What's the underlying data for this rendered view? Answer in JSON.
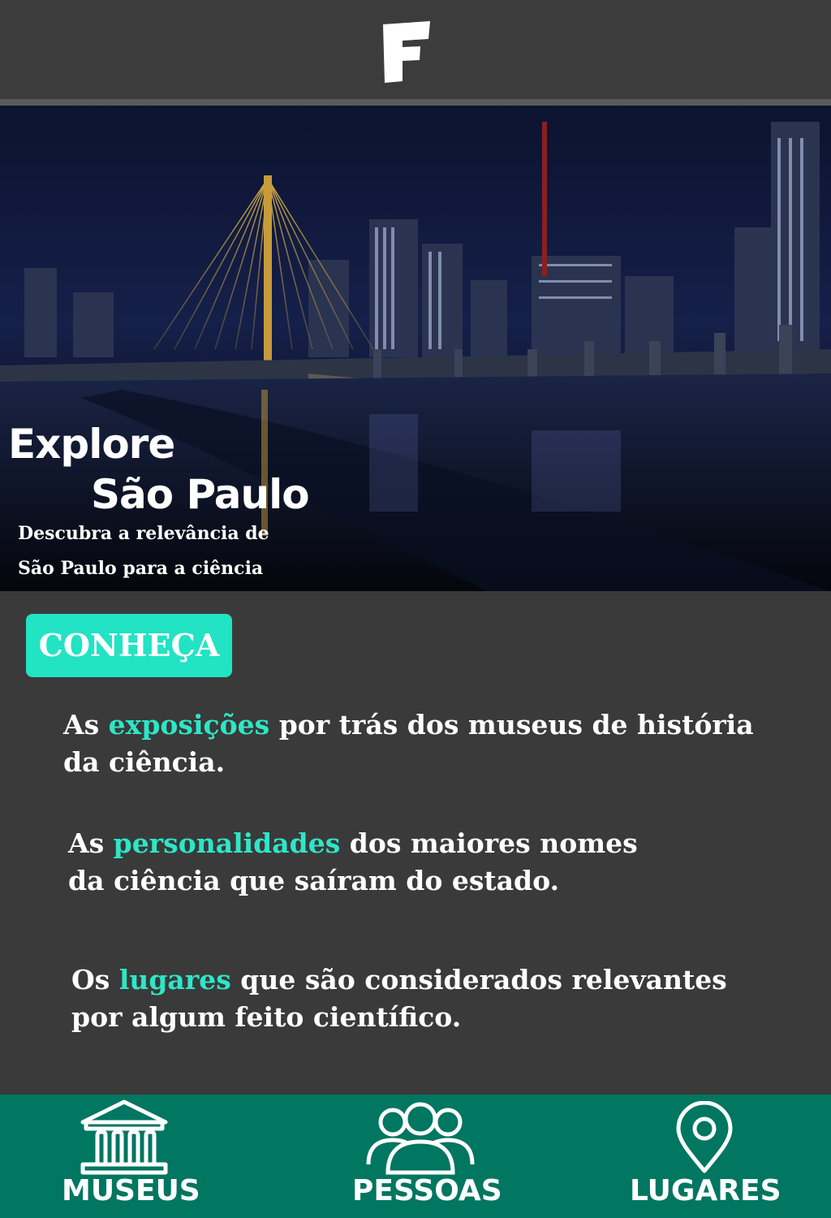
{
  "header": {
    "logo_icon": "f-logo-icon"
  },
  "hero": {
    "title_line1": "Explore",
    "title_line2": "São Paulo",
    "subtitle_line1": "Descubra a relevância de",
    "subtitle_line2": "São Paulo para a ciência"
  },
  "main": {
    "cta_label": "CONHEÇA",
    "paragraphs": [
      {
        "before": "As ",
        "highlight": "exposições",
        "after": " por trás dos museus de história",
        "line2": "da ciência."
      },
      {
        "before": "As ",
        "highlight": "personalidades",
        "after": " dos maiores nomes",
        "line2": "da ciência que saíram do estado."
      },
      {
        "before": "Os ",
        "highlight": "lugares",
        "after": " que são considerados relevantes",
        "line2": "por algum feito científico."
      }
    ]
  },
  "nav": {
    "items": [
      {
        "label": "MUSEUS",
        "icon": "museum-icon"
      },
      {
        "label": "PESSOAS",
        "icon": "people-icon"
      },
      {
        "label": "LUGARES",
        "icon": "location-pin-icon"
      }
    ]
  },
  "colors": {
    "accent": "#22e3c3",
    "highlight": "#2ee6c6",
    "nav_bg": "#017660",
    "background": "#3a3a3a",
    "header_bg": "#3c3c3c"
  }
}
